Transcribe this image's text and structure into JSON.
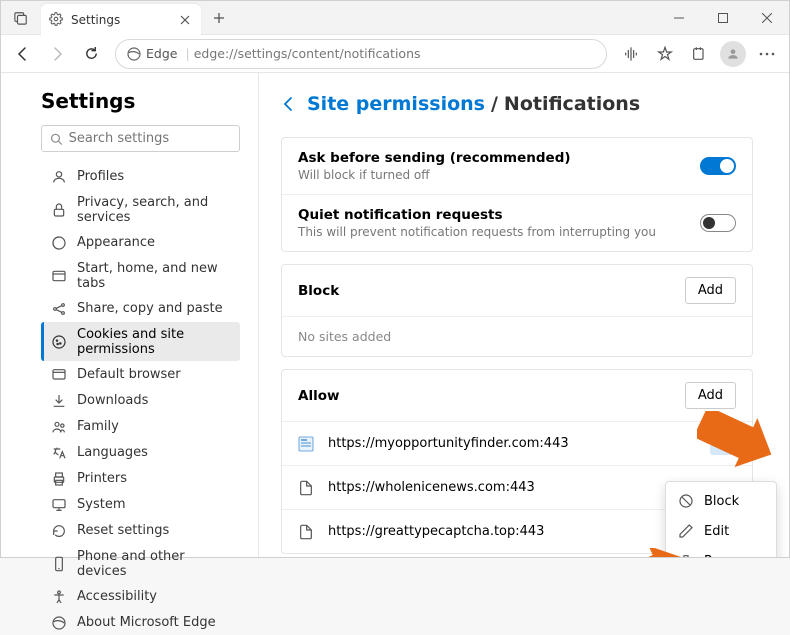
{
  "tab": {
    "title": "Settings"
  },
  "address": {
    "scheme_label": "Edge",
    "url": "edge://settings/content/notifications"
  },
  "sidebar": {
    "heading": "Settings",
    "search_placeholder": "Search settings",
    "items": [
      {
        "label": "Profiles"
      },
      {
        "label": "Privacy, search, and services"
      },
      {
        "label": "Appearance"
      },
      {
        "label": "Start, home, and new tabs"
      },
      {
        "label": "Share, copy and paste"
      },
      {
        "label": "Cookies and site permissions"
      },
      {
        "label": "Default browser"
      },
      {
        "label": "Downloads"
      },
      {
        "label": "Family"
      },
      {
        "label": "Languages"
      },
      {
        "label": "Printers"
      },
      {
        "label": "System"
      },
      {
        "label": "Reset settings"
      },
      {
        "label": "Phone and other devices"
      },
      {
        "label": "Accessibility"
      },
      {
        "label": "About Microsoft Edge"
      }
    ]
  },
  "breadcrumb": {
    "parent": "Site permissions",
    "current": "Notifications"
  },
  "settings": {
    "ask": {
      "title": "Ask before sending (recommended)",
      "desc": "Will block if turned off"
    },
    "quiet": {
      "title": "Quiet notification requests",
      "desc": "This will prevent notification requests from interrupting you"
    }
  },
  "block": {
    "title": "Block",
    "add": "Add",
    "empty": "No sites added"
  },
  "allow": {
    "title": "Allow",
    "add": "Add",
    "sites": [
      {
        "url": "https://myopportunityfinder.com:443"
      },
      {
        "url": "https://wholenicenews.com:443"
      },
      {
        "url": "https://greattypecaptcha.top:443"
      }
    ]
  },
  "ctx": {
    "block": "Block",
    "edit": "Edit",
    "remove": "Remove"
  }
}
